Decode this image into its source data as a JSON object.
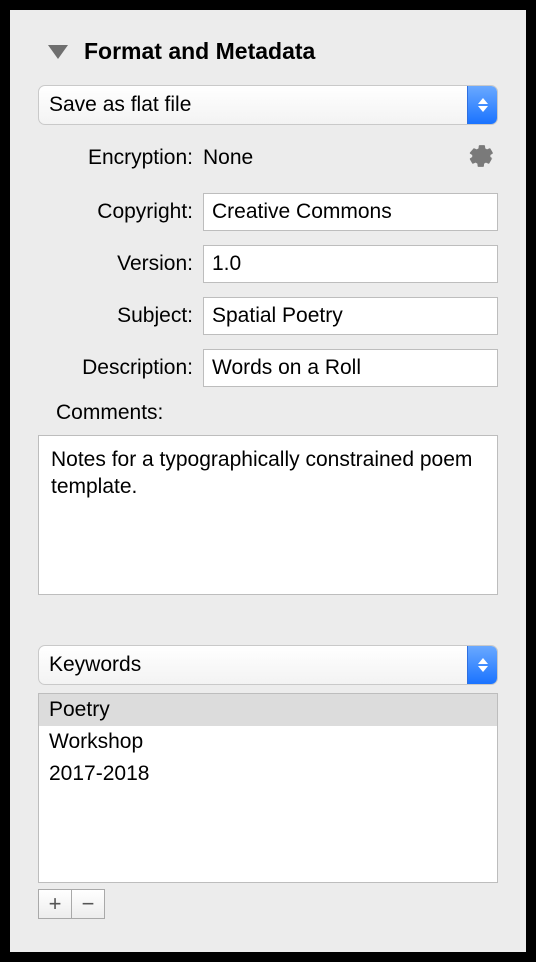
{
  "section": {
    "title": "Format and Metadata"
  },
  "saveMode": {
    "selected": "Save as flat file"
  },
  "encryption": {
    "label": "Encryption:",
    "value": "None"
  },
  "fields": {
    "copyright": {
      "label": "Copyright:",
      "value": "Creative Commons"
    },
    "version": {
      "label": "Version:",
      "value": "1.0"
    },
    "subject": {
      "label": "Subject:",
      "value": "Spatial Poetry"
    },
    "description": {
      "label": "Description:",
      "value": "Words on a Roll"
    }
  },
  "comments": {
    "label": "Comments:",
    "value": "Notes for a typographically constrained poem template."
  },
  "keywords": {
    "dropdown_selected": "Keywords",
    "items": [
      {
        "label": "Poetry",
        "selected": true
      },
      {
        "label": "Workshop",
        "selected": false
      },
      {
        "label": "2017-2018",
        "selected": false
      }
    ]
  },
  "buttons": {
    "add": "+",
    "remove": "−"
  }
}
